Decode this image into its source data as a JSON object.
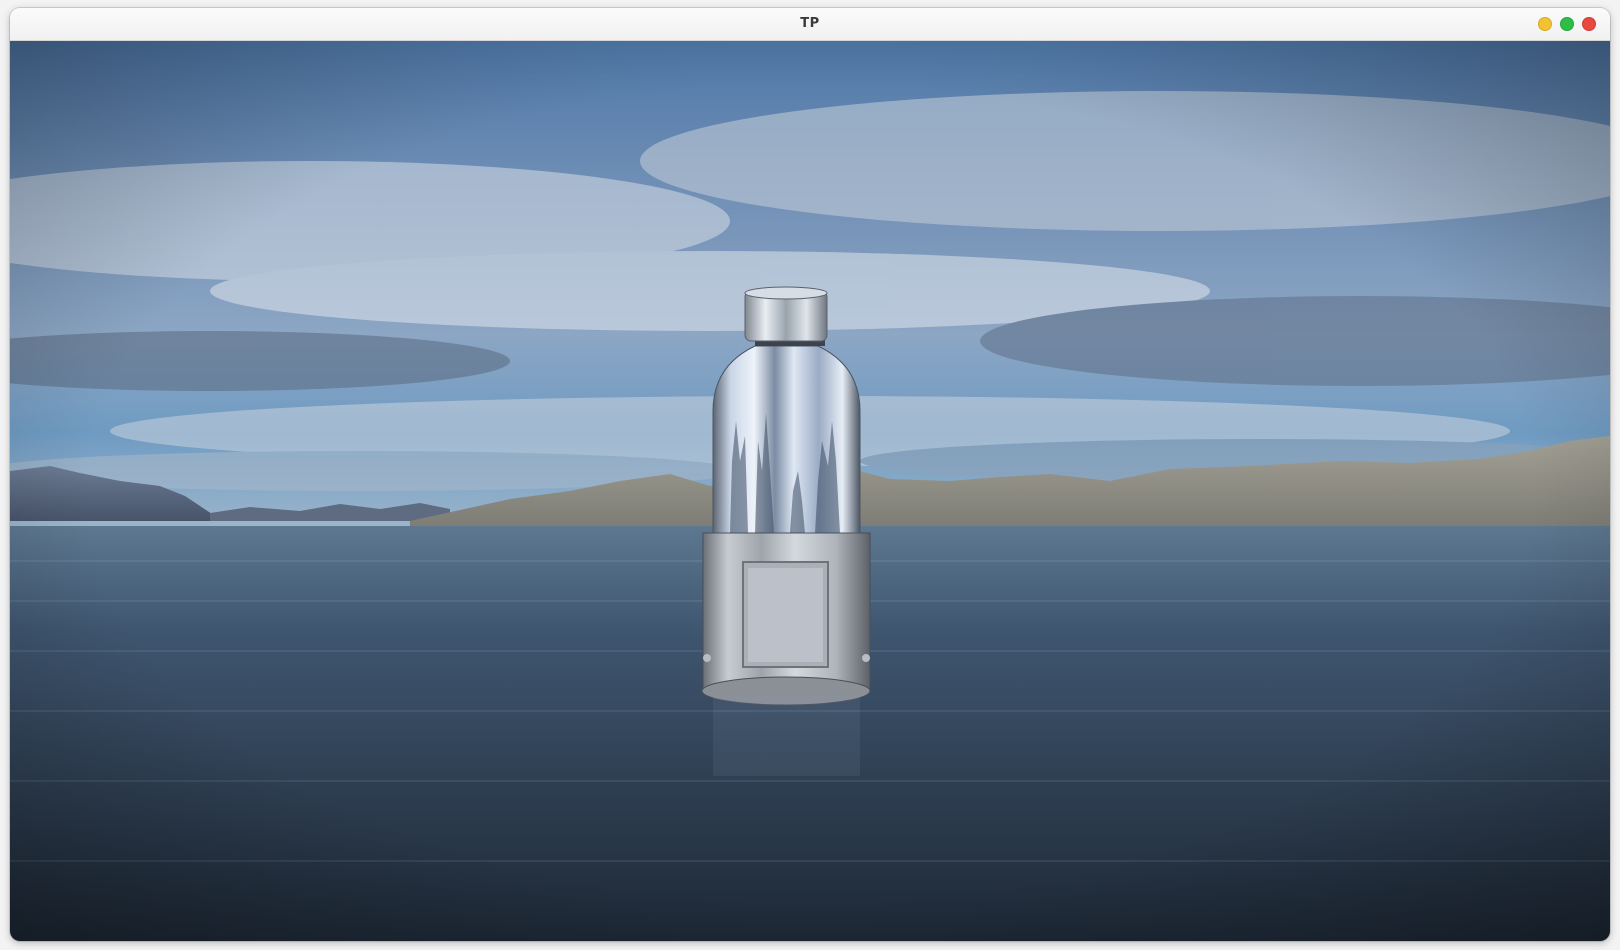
{
  "window": {
    "title": "TP",
    "controls": {
      "minimize_color": "#F2C230",
      "maximize_color": "#2DBE47",
      "close_color": "#E9483F"
    }
  },
  "scene": {
    "sky_color": "#5F86B4",
    "water_color": "#2E3F52",
    "mountain_color": "#8E8D85",
    "bottle_material": "chrome"
  }
}
